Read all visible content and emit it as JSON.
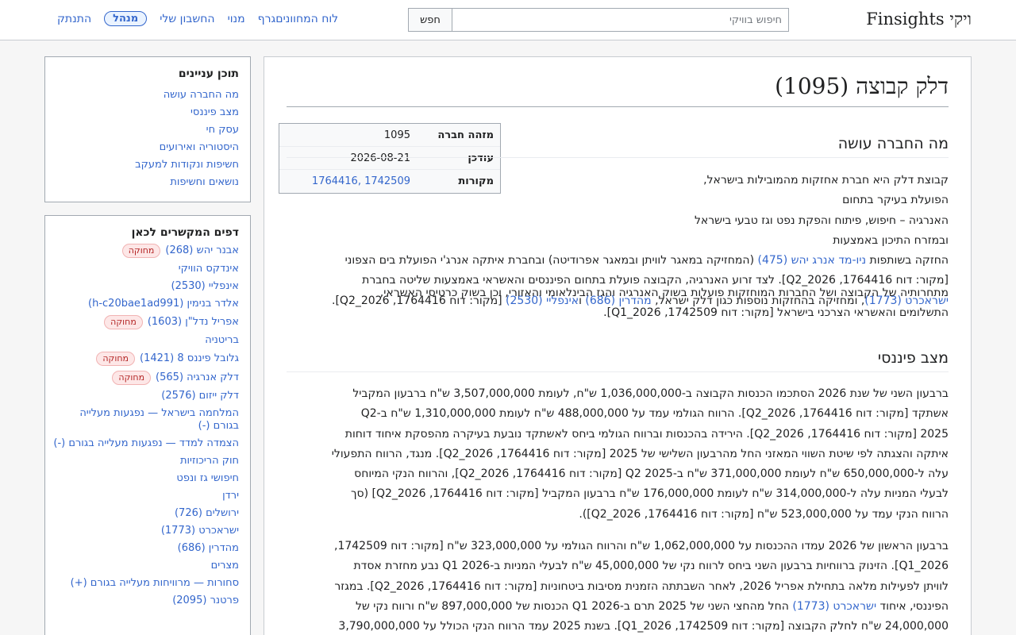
{
  "header": {
    "brand": "ויקי Finsights",
    "search_placeholder": "חיפוש בוויקי",
    "search_button": "חפש",
    "nav": [
      {
        "label": "לוח המחוונים",
        "name": "nav-dashboard"
      },
      {
        "label": "גרף",
        "name": "nav-graph"
      },
      {
        "label": "מנוי",
        "name": "nav-subscription"
      },
      {
        "label": "החשבון שלי",
        "name": "nav-my-account"
      },
      {
        "label": "מנהל",
        "name": "nav-admin"
      },
      {
        "label": "התנתק",
        "name": "nav-logout"
      }
    ]
  },
  "toc": {
    "title": "תוכן עניינים",
    "items": [
      "מה החברה עושה",
      "מצב פיננסי",
      "עסק חי",
      "היסטוריה ואירועים",
      "חשיפות ונקודות למעקב",
      "נושאים וחשיפות"
    ]
  },
  "links_here": {
    "title": "דפים המקשרים לכאן",
    "disputed_label": "מחוקה",
    "items": [
      {
        "label": "אבנר יהש (268)",
        "disputed": true
      },
      {
        "label": "אינדקס הוויקי",
        "disputed": false
      },
      {
        "label": "אינפליי (2530)",
        "disputed": false
      },
      {
        "label": "אלדר בנימין (h-c20bae1ad991)",
        "disputed": false
      },
      {
        "label": "אפריל נדל\"ן (1603)",
        "disputed": true
      },
      {
        "label": "בריטניה",
        "disputed": false
      },
      {
        "label": "גלובל פיננס 8 (1421)",
        "disputed": true
      },
      {
        "label": "דלק אנרגיה (565)",
        "disputed": true
      },
      {
        "label": "דלק ייזום (2576)",
        "disputed": false
      },
      {
        "label": "המלחמה בישראל — נפגעות מעלייה בגורם (-)",
        "disputed": false
      },
      {
        "label": "הצמדה למדד — נפגעות מעלייה בגורם (-)",
        "disputed": false
      },
      {
        "label": "חוק הריכוזיות",
        "disputed": false
      },
      {
        "label": "חיפושי גז ונפט",
        "disputed": false
      },
      {
        "label": "ירדן",
        "disputed": false
      },
      {
        "label": "ירושלים (726)",
        "disputed": false
      },
      {
        "label": "ישראכרט (1773)",
        "disputed": false
      },
      {
        "label": "מהדרין (686)",
        "disputed": false
      },
      {
        "label": "מצרים",
        "disputed": false
      },
      {
        "label": "סחורות — מרוויחות מעלייה בגורם (+)",
        "disputed": false
      },
      {
        "label": "פרטנר (2095)",
        "disputed": false
      }
    ]
  },
  "article": {
    "title": "דלק קבוצה (1095)",
    "infobox": [
      {
        "key": "מזהה חברה",
        "value": "1095"
      },
      {
        "key": "עודכן",
        "value": "2026-08-21"
      },
      {
        "key": "מקורות",
        "value": "1742509 ,1764416"
      }
    ],
    "section1": {
      "heading": "מה החברה עושה",
      "p1": [
        "קבוצת דלק היא חברת אחזקות מהמובילות בישראל, הפועלת בעיקר בתחום",
        "האנרגיה – חיפוש, פיתוח והפקת נפט וגז טבעי בישראל ובמזרח התיכון באמצעות",
        "ניו-מד אנרג יהש (475)",
        "החזקה בשותפות ",
        " (המחזיקה במאגר לוויתן ובמאגר אפרודיטה) ובחברת איתקה אנרג'י הפועלת בים הצפוני",
        "[מקור: דוח 1764416, Q2_2026]. לצד זרוע האנרגיה, הקבוצה פועלת בתחום הפיננסים והאשראי באמצעות שליטה בחברת",
        "ישראכרט (1773)",
        ", ומחזיקה בהחזקות נוספות כגון דלק ישראל, ",
        "מהדרין (686)",
        " ו",
        "אינפליי (2530)",
        " [מקור: דוח 1764416, Q2_2026]."
      ],
      "p2": [
        "מתחרותיה של הקבוצה ושל החברות המוחזקות פועלות בשוק האנרגיה והגז הבינלאומי והאזורי, וכן בשוק כרטיסי האשראי,",
        "התשלומים והאשראי הצרכני בישראל [מקור: דוח 1742509, Q1_2026]."
      ]
    },
    "section2": {
      "heading": "מצב פיננסי",
      "p1": [
        "ברבעון השני של שנת 2026 הסתכמו הכנסות הקבוצה ב-1,036,000,000 ש\"ח, לעומת 3,507,000,000 ש\"ח ברבעון המקביל",
        "אשתקד [מקור: דוח 1764416, Q2_2026]. הרווח הגולמי עמד על 488,000,000 ש\"ח לעומת 1,310,000,000 ש\"ח ב-Q2",
        "2025 [מקור: דוח 1764416, Q2_2026]. הירידה בהכנסות וברווח הגולמי ביחס לאשתקד נובעת בעיקרה מהפסקת איחוד דוחות",
        "איתקה והצגתה לפי שיטת השווי המאזני החל מהרבעון השלישי של 2025 [מקור: דוח 1764416, Q2_2026]. מנגד, הרווח התפעולי",
        "עלה ל-650,000,000 ש\"ח לעומת 371,000,000 ש\"ח ב-Q2 2025 [מקור: דוח 1764416, Q2_2026], והרווח הנקי המיוחס",
        "לבעלי המניות עלה ל-314,000,000 ש\"ח לעומת 176,000,000 ש\"ח ברבעון המקביל [מקור: דוח 1764416, Q2_2026] (סך",
        "הרווח הנקי עמד על 523,000,000 ש\"ח [מקור: דוח 1764416, Q2_2026])."
      ],
      "p2": [
        "ברבעון הראשון של 2026 עמדו ההכנסות על 1,062,000,000 ש\"ח והרווח הגולמי על 323,000,000 ש\"ח [מקור: דוח 1742509,",
        "Q1_2026]. הזינוק ברווחיות ברבעון השני ביחס לרווח נקי של 45,000,000 ש\"ח לבעלי המניות ב-Q1 2026 נבע מחזרת אסדת",
        "לוויתן לפעילות מלאה בתחילת אפריל 2026, לאחר השבתתה הזמנית מסיבות ביטחוניות [מקור: דוח 1764416, Q2_2026]. במגזר",
        "הפיננסי, איחוד ",
        "ישראכרט (1773)",
        " החל מהחצי השני של 2025 תרם ב-Q1 2026 הכנסות של 897,000,000 ש\"ח ורווח נקי של",
        "24,000,000 ש\"ח לחלק הקבוצה [מקור: דוח 1742509, Q1_2026]. בשנת 2025 עמד הרווח הנקי הכולל על 3,790,000,000"
      ]
    }
  }
}
